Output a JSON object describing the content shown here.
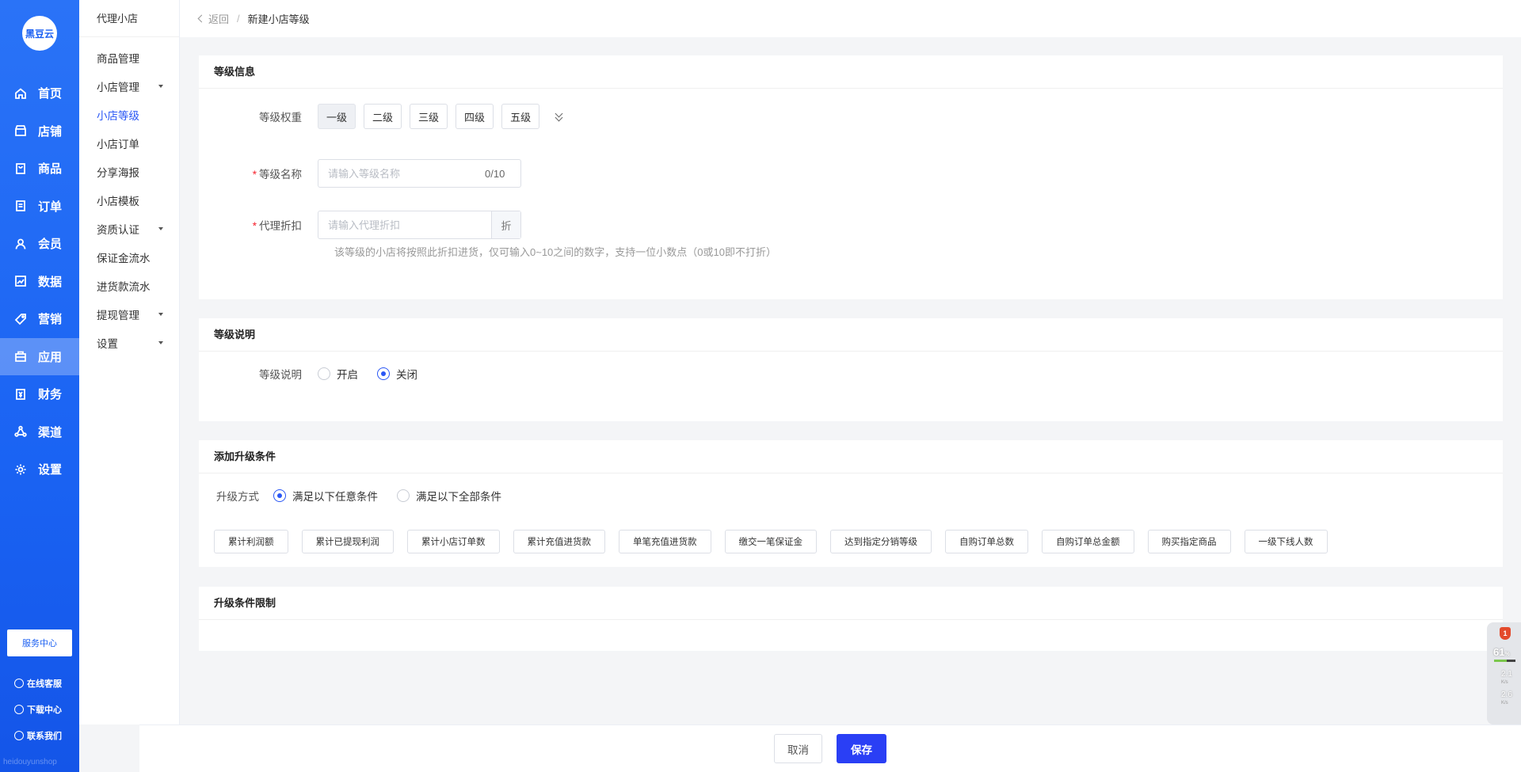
{
  "brand": {
    "logo_text": "黑豆云",
    "watermark": "heidouyunshop"
  },
  "nav": {
    "items": [
      {
        "label": "首页",
        "icon": "home-icon"
      },
      {
        "label": "店铺",
        "icon": "store-icon"
      },
      {
        "label": "商品",
        "icon": "goods-icon"
      },
      {
        "label": "订单",
        "icon": "order-icon"
      },
      {
        "label": "会员",
        "icon": "user-icon"
      },
      {
        "label": "数据",
        "icon": "chart-icon"
      },
      {
        "label": "营销",
        "icon": "tag-icon"
      },
      {
        "label": "应用",
        "icon": "app-icon",
        "active": true
      },
      {
        "label": "财务",
        "icon": "finance-icon"
      },
      {
        "label": "渠道",
        "icon": "channel-icon"
      },
      {
        "label": "设置",
        "icon": "gear-icon"
      }
    ],
    "service_center": "服务中心",
    "bottom": [
      "在线客服",
      "下载中心",
      "联系我们"
    ]
  },
  "subnav": {
    "title": "代理小店",
    "items": [
      {
        "label": "商品管理",
        "caret": false
      },
      {
        "label": "小店管理",
        "caret": true
      },
      {
        "label": "小店等级",
        "caret": false,
        "active": true
      },
      {
        "label": "小店订单",
        "caret": false
      },
      {
        "label": "分享海报",
        "caret": false
      },
      {
        "label": "小店模板",
        "caret": false
      },
      {
        "label": "资质认证",
        "caret": true
      },
      {
        "label": "保证金流水",
        "caret": false
      },
      {
        "label": "进货款流水",
        "caret": false
      },
      {
        "label": "提现管理",
        "caret": true
      },
      {
        "label": "设置",
        "caret": true
      }
    ]
  },
  "header": {
    "back": "返回",
    "separator": "/",
    "title": "新建小店等级"
  },
  "level_info": {
    "title": "等级信息",
    "weight_label": "等级权重",
    "levels": [
      "一级",
      "二级",
      "三级",
      "四级",
      "五级"
    ],
    "selected_level": "一级",
    "name_label": "等级名称",
    "name_placeholder": "请输入等级名称",
    "name_count": "0/10",
    "discount_label": "代理折扣",
    "discount_placeholder": "请输入代理折扣",
    "discount_suffix": "折",
    "discount_hint": "该等级的小店将按照此折扣进货，仅可输入0~10之间的数字，支持一位小数点（0或10即不打折）"
  },
  "level_desc": {
    "title": "等级说明",
    "label": "等级说明",
    "options": [
      "开启",
      "关闭"
    ],
    "selected": "关闭"
  },
  "upgrade": {
    "title": "添加升级条件",
    "method_label": "升级方式",
    "options": [
      "满足以下任意条件",
      "满足以下全部条件"
    ],
    "selected": "满足以下任意条件",
    "conditions": [
      "累计利润额",
      "累计已提现利润",
      "累计小店订单数",
      "累计充值进货款",
      "单笔充值进货款",
      "缴交一笔保证金",
      "达到指定分销等级",
      "自购订单总数",
      "自购订单总金额",
      "购买指定商品",
      "一级下线人数"
    ]
  },
  "limit": {
    "title": "升级条件限制"
  },
  "footer": {
    "cancel": "取消",
    "save": "保存"
  },
  "monitor": {
    "badge": "1",
    "percent": "61",
    "percent_unit": "%",
    "up": "2.1",
    "down": "2.6",
    "unit": "K/s"
  },
  "colors": {
    "primary": "#2a57f5",
    "nav_bg": "#1a63f3",
    "save_btn": "#2a3ff5",
    "required": "#f5222d"
  }
}
